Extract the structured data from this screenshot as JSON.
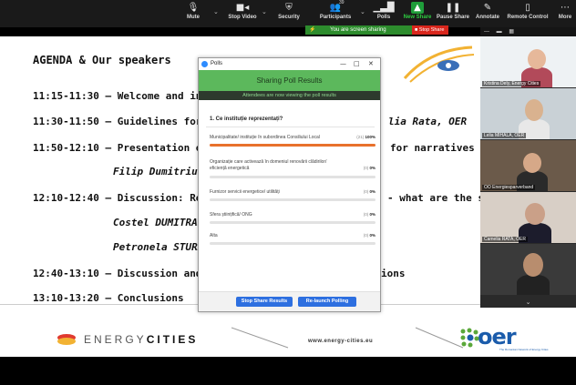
{
  "toolbar": {
    "mute": "Mute",
    "stop_video": "Stop Video",
    "security": "Security",
    "participants": "Participants",
    "participants_count": "39",
    "polls": "Polls",
    "new_share": "New Share",
    "pause_share": "Pause Share",
    "annotate": "Annotate",
    "remote_control": "Remote Control",
    "more": "More"
  },
  "share_bar": {
    "status": "You are screen sharing",
    "stop_label": "Stop Share"
  },
  "slide": {
    "title": "AGENDA & Our speakers",
    "lines": [
      {
        "time": "11:15-11:30 –",
        "text": "Welcome and intr"
      },
      {
        "time": "11:30-11:50 –",
        "text": "Guidelines for de",
        "suffix": "lia Rata, OER"
      },
      {
        "time": "11:50-12:10 –",
        "text": "Presentation of E",
        "suffix": "for narratives dev"
      },
      {
        "name": "Filip Dumitriu, FE"
      },
      {
        "time": "12:10-12:40 –",
        "text": "Discussion: Reno",
        "suffix": "- what are the su"
      },
      {
        "name": "Costel DUMITRAȘ"
      },
      {
        "name": "Petronela STURZ,"
      },
      {
        "time": "12:40-13:10 –",
        "text": "Discussion and inp",
        "suffix": "ions"
      },
      {
        "time": "13:10-13:20 –",
        "text": "Conclusions"
      }
    ],
    "footer_energy": "ENERGY",
    "footer_cities": "CITIES",
    "footer_url": "www.energy-cities.eu",
    "oer_logo": "oer",
    "oer_sub": "The Romanian Network of Energy Cities"
  },
  "videos": {
    "tiles": [
      {
        "name": "Kristina Dely, Energy Cities"
      },
      {
        "name": "Lelia MIHALA, OER"
      },
      {
        "name": "OO Energiesparverband"
      },
      {
        "name": "Camelia RATA, OER"
      },
      {
        "name": ""
      }
    ]
  },
  "polls": {
    "window_title": "Polls",
    "header": "Sharing Poll Results",
    "subheader": "Attendees are now viewing the poll results",
    "question": "1. Ce instituție reprezentați?",
    "answers": [
      {
        "text": "Municipalitate/ instituție în subordinea Consiliului Local",
        "count": "(21)",
        "pct": "100%",
        "fraction": 1.0
      },
      {
        "text": "Organizație care activează în domeniul renovării clădirilor/ eficiență energetică",
        "count": "(0)",
        "pct": "0%",
        "fraction": 0
      },
      {
        "text": "Furnizor servicii energetice/ utilități",
        "count": "(0)",
        "pct": "0%",
        "fraction": 0
      },
      {
        "text": "Sfera științifică/ ONG",
        "count": "(0)",
        "pct": "0%",
        "fraction": 0
      },
      {
        "text": "Alta",
        "count": "(0)",
        "pct": "0%",
        "fraction": 0
      }
    ],
    "stop_button": "Stop Share Results",
    "relaunch_button": "Re-launch Polling"
  }
}
